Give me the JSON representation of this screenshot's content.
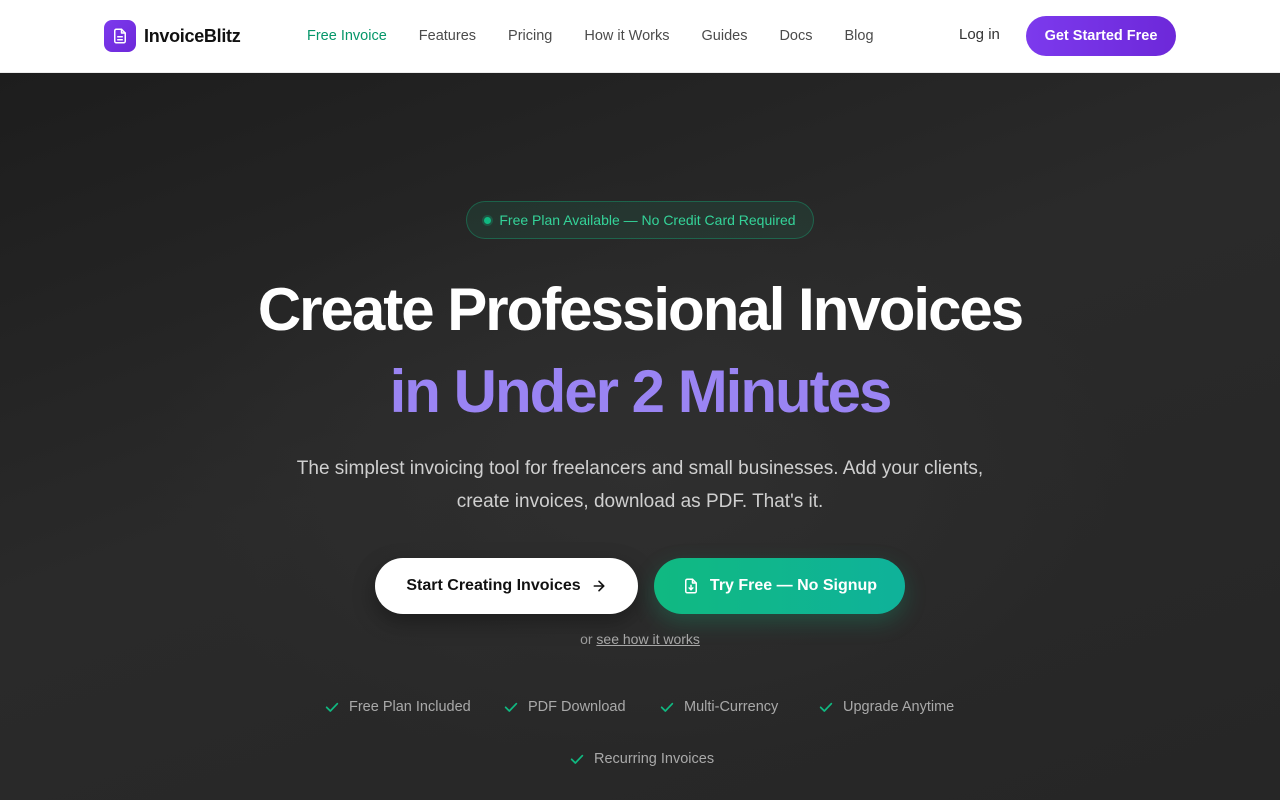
{
  "nav": {
    "brand": "InvoiceBlitz",
    "links": [
      {
        "label": "Free Invoice",
        "active": true
      },
      {
        "label": "Features",
        "active": false
      },
      {
        "label": "Pricing",
        "active": false
      },
      {
        "label": "How it Works",
        "active": false
      },
      {
        "label": "Guides",
        "active": false
      },
      {
        "label": "Docs",
        "active": false
      },
      {
        "label": "Blog",
        "active": false
      }
    ],
    "login": "Log in",
    "cta": "Get Started Free"
  },
  "hero": {
    "badge": "Free Plan Available — No Credit Card Required",
    "headline": "Create Professional Invoices",
    "headline_accent": "in Under 2 Minutes",
    "subtitle": "The simplest invoicing tool for freelancers and small businesses. Add your clients, create invoices, download as PDF. That's it.",
    "primary_button": "Start Creating Invoices",
    "secondary_button": "Try Free — No Signup",
    "or_text": "or",
    "how_link": "see how it works",
    "features": [
      "Free Plan Included",
      "PDF Download",
      "Multi-Currency",
      "Upgrade Anytime",
      "Recurring Invoices"
    ]
  },
  "colors": {
    "brand_purple": "#7c3aed",
    "accent_green": "#10b981",
    "accent_violet_text": "#9a84f3",
    "hero_background": "#232323"
  },
  "icons": {
    "logo": "document-icon",
    "arrow": "arrow-right-icon",
    "download": "file-download-icon",
    "check": "check-icon"
  }
}
